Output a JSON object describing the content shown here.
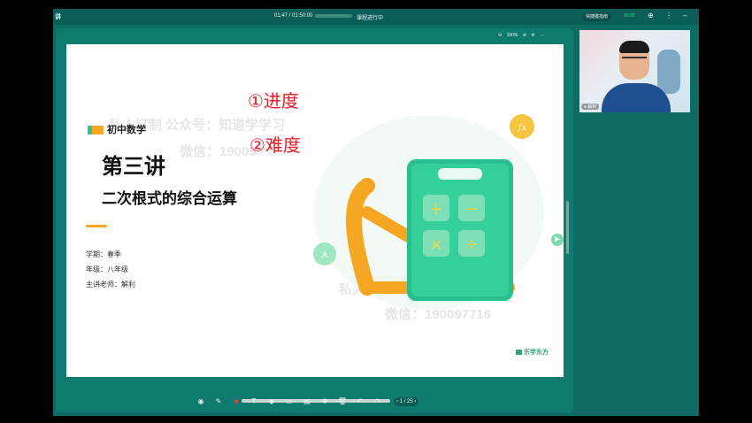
{
  "window": {
    "title": "讲",
    "time": "01:47 / 01:50:00",
    "status": "课程进行中",
    "hint": "快捷键指南",
    "timer": "06:05"
  },
  "board": {
    "zoom": "100%"
  },
  "slide": {
    "subject": "初中数学",
    "lecture": "第三讲",
    "topic": "二次根式的综合运算",
    "semester": "学期：春季",
    "grade": "年级：八年级",
    "teacher": "主讲老师：解利",
    "brand": "乐学东方",
    "watermark1": "私人订制 公众号：知道学学习",
    "watermark2": "微信：19009****",
    "watermark3": "私人订制 公众号：知道学学习",
    "watermark4": "微信：190097716",
    "annot1": "①进度",
    "annot2": "②难度"
  },
  "pager": {
    "current": "1",
    "total": "/ 25"
  },
  "video": {
    "name": "解利"
  },
  "colors": {
    "accent": "#0d6b63",
    "board": "#0f7a70",
    "orange": "#f5a623",
    "green": "#34c38f",
    "calculator": "#2bbf8f"
  }
}
